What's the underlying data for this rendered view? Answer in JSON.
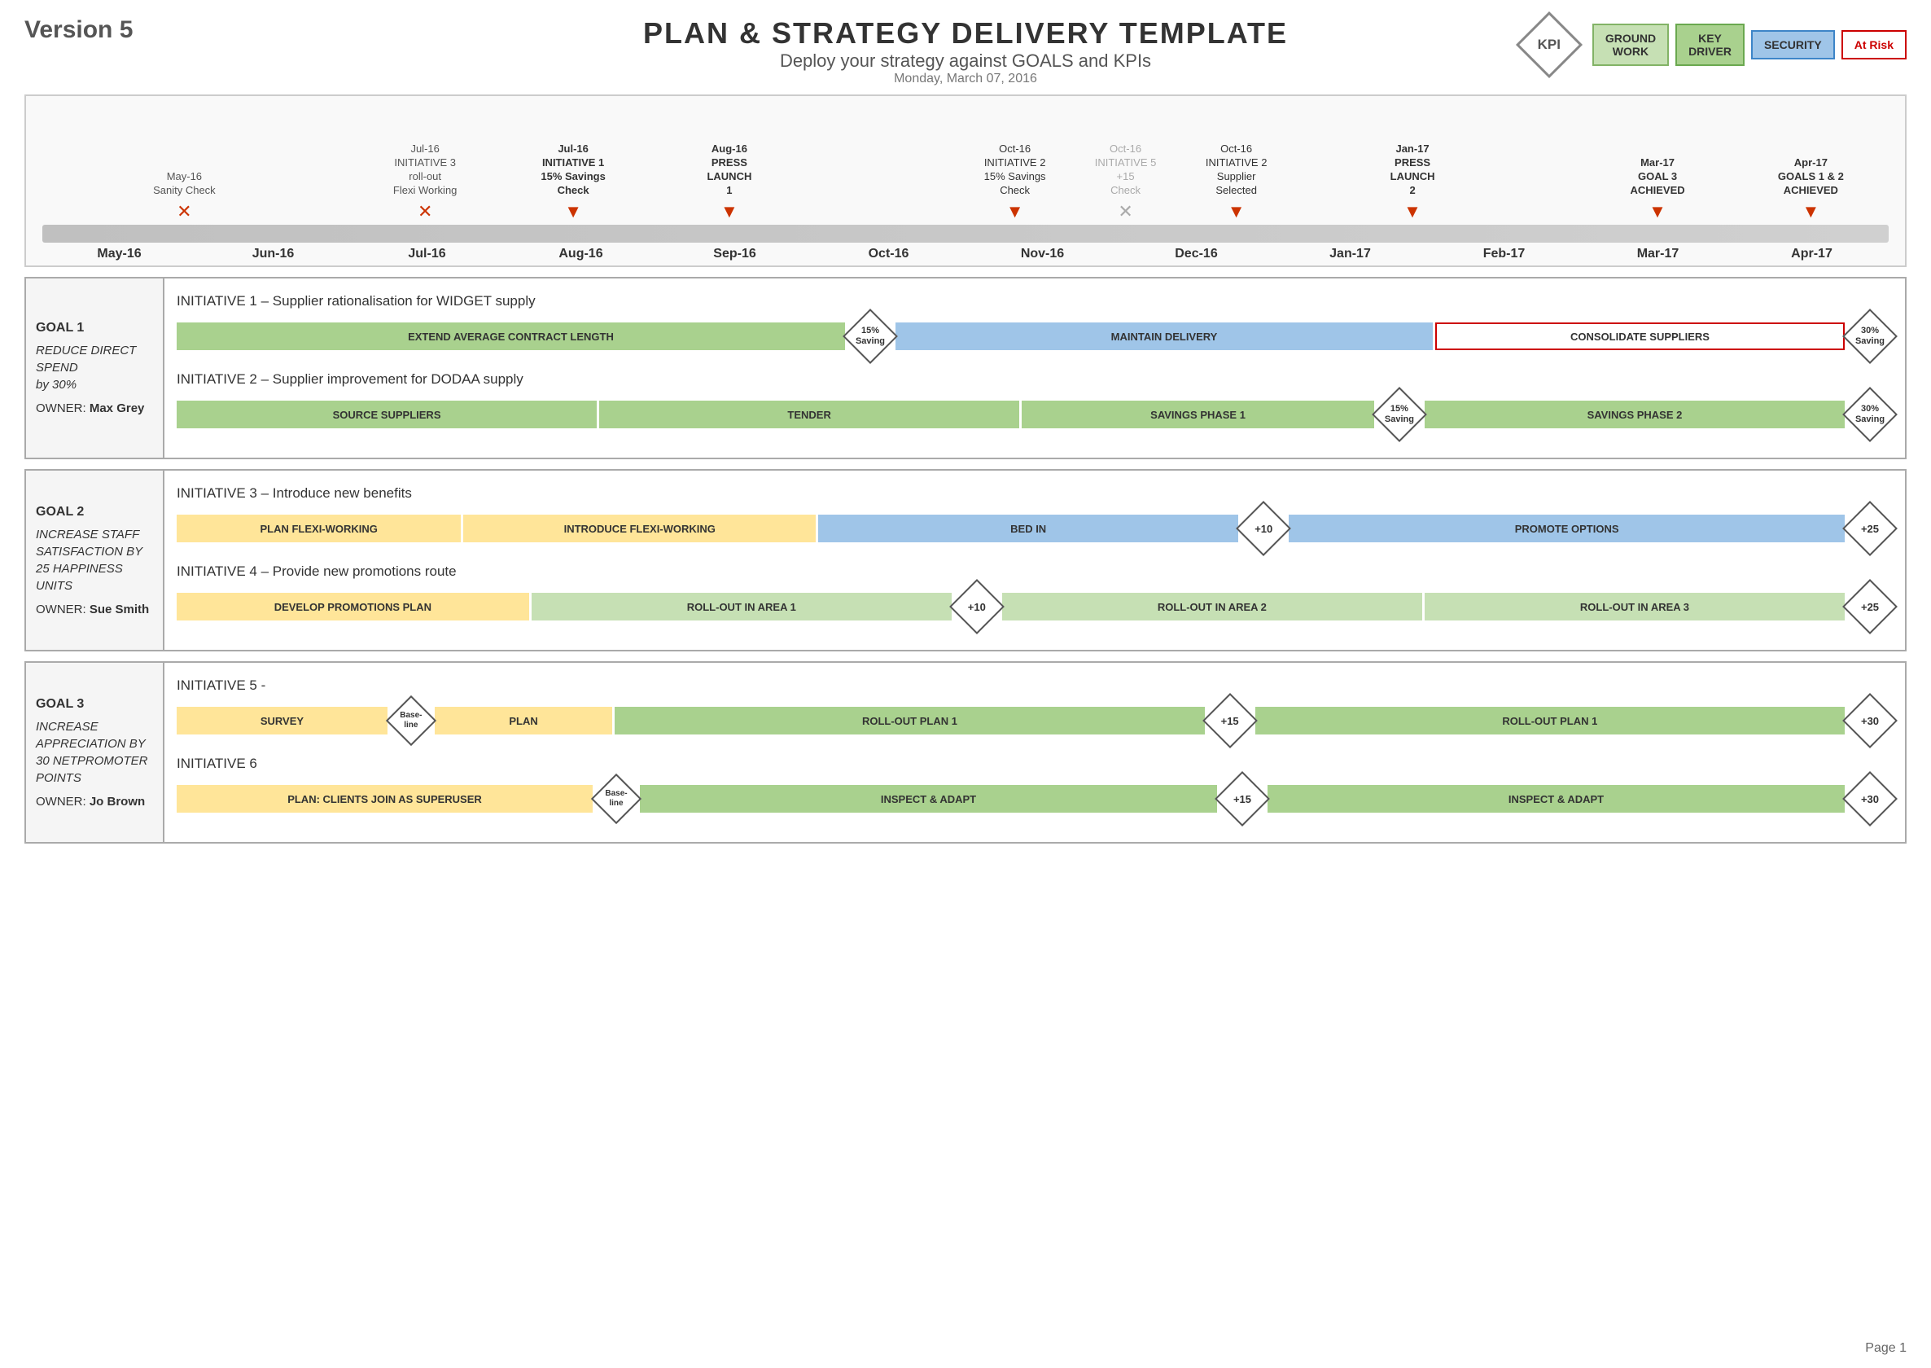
{
  "header": {
    "title": "PLAN & STRATEGY DELIVERY TEMPLATE",
    "subtitle": "Deploy your strategy against GOALS and KPIs",
    "date": "Monday, March 07, 2016",
    "version": "Version 5",
    "kpi_label": "KPI"
  },
  "legend": {
    "groundwork": "GROUND\nWORK",
    "keydriver": "KEY\nDRIVER",
    "security": "SECURITY",
    "atrisk": "At Risk"
  },
  "timeline": {
    "months": [
      "May-16",
      "Jun-16",
      "Jul-16",
      "Aug-16",
      "Sep-16",
      "Oct-16",
      "Nov-16",
      "Dec-16",
      "Jan-17",
      "Feb-17",
      "Mar-17",
      "Apr-17"
    ],
    "milestones": [
      {
        "date": "May-16",
        "label": "Sanity Check",
        "bold": false,
        "marker": "x",
        "offset": 8
      },
      {
        "date": "Jul-16",
        "label": "INITIATIVE 3\nroll-out\nFlexi Working",
        "bold": false,
        "marker": "x",
        "offset": 16
      },
      {
        "date": "Jul-16",
        "label": "Jul-16\nINITIATIVE 1\n15% Savings\nCheck",
        "bold": true,
        "marker": "arrow",
        "offset": 23
      },
      {
        "date": "Aug-16",
        "label": "Aug-16\nPRESS\nLAUNCH\n1",
        "bold": true,
        "marker": "arrow",
        "offset": 31
      },
      {
        "date": "Oct-16",
        "label": "Oct-16\nINITIATIVE 2\n15% Savings\nCheck",
        "bold": false,
        "marker": "arrow",
        "offset": 46
      },
      {
        "date": "Oct-16",
        "label": "Oct-16\nINITIATIVE 5\n+15\nCheck",
        "bold": false,
        "gray": true,
        "marker": "x",
        "offset": 52
      },
      {
        "date": "Oct-16",
        "label": "Oct-16\nINITIATIVE 2\nSupplier\nSelected",
        "bold": false,
        "marker": "arrow",
        "offset": 59
      },
      {
        "date": "Jan-17",
        "label": "Jan-17\nPRESS\nLAUNCH\n2",
        "bold": true,
        "marker": "arrow",
        "offset": 70
      },
      {
        "date": "Mar-17",
        "label": "Mar-17\nGOAL 3\nACHIEVED",
        "bold": true,
        "marker": "arrow",
        "offset": 85
      },
      {
        "date": "Apr-17",
        "label": "Apr-17\nGOALS 1 & 2\nACHIEVED",
        "bold": true,
        "marker": "arrow",
        "offset": 93
      }
    ]
  },
  "goals": [
    {
      "id": "goal1",
      "header": "GOAL 1",
      "sidebar": {
        "text": "REDUCE DIRECT SPEND\nby 30%",
        "owner_label": "OWNER:",
        "owner_name": "Max Grey"
      },
      "initiatives": [
        {
          "title": "INITIATIVE 1 – Supplier rationalisation for WIDGET supply",
          "bars": [
            {
              "label": "EXTEND AVERAGE CONTRACT LENGTH",
              "type": "green",
              "flex": 5
            },
            {
              "label": "15%\nSaving",
              "type": "diamond",
              "size": "normal"
            },
            {
              "label": "MAINTAIN DELIVERY",
              "type": "blue",
              "flex": 4
            },
            {
              "label": "CONSOLIDATE SUPPLIERS",
              "type": "red-outline",
              "flex": 3
            },
            {
              "label": "30%\nSaving",
              "type": "diamond",
              "size": "normal"
            }
          ]
        },
        {
          "title": "INITIATIVE 2 – Supplier improvement for DODAA supply",
          "bars": [
            {
              "label": "SOURCE SUPPLIERS",
              "type": "green",
              "flex": 3
            },
            {
              "label": "TENDER",
              "type": "green",
              "flex": 3
            },
            {
              "label": "SAVINGS PHASE 1",
              "type": "green",
              "flex": 2.5
            },
            {
              "label": "15%\nSaving",
              "type": "diamond",
              "size": "normal"
            },
            {
              "label": "SAVINGS PHASE 2",
              "type": "green",
              "flex": 3
            },
            {
              "label": "30%\nSaving",
              "type": "diamond",
              "size": "normal"
            }
          ]
        }
      ]
    },
    {
      "id": "goal2",
      "header": "GOAL 2",
      "sidebar": {
        "text": "INCREASE STAFF SATISFACTION BY 25 HAPPINESS UNITS",
        "owner_label": "OWNER:",
        "owner_name": "Sue Smith"
      },
      "initiatives": [
        {
          "title": "INITIATIVE 3 – Introduce new benefits",
          "bars": [
            {
              "label": "PLAN FLEXI-WORKING",
              "type": "yellow",
              "flex": 2
            },
            {
              "label": "INTRODUCE FLEXI-WORKING",
              "type": "yellow",
              "flex": 2.5
            },
            {
              "label": "BED IN",
              "type": "blue",
              "flex": 3
            },
            {
              "label": "+10",
              "type": "diamond",
              "size": "normal"
            },
            {
              "label": "PROMOTE OPTIONS",
              "type": "blue",
              "flex": 4
            },
            {
              "label": "+25",
              "type": "diamond",
              "size": "normal"
            }
          ]
        },
        {
          "title": "INITIATIVE 4 – Provide new promotions route",
          "bars": [
            {
              "label": "DEVELOP PROMOTIONS PLAN",
              "type": "yellow",
              "flex": 2.5
            },
            {
              "label": "ROLL-OUT IN AREA 1",
              "type": "light-green",
              "flex": 3
            },
            {
              "label": "+10",
              "type": "diamond",
              "size": "normal"
            },
            {
              "label": "ROLL-OUT IN AREA 2",
              "type": "light-green",
              "flex": 3
            },
            {
              "label": "ROLL-OUT IN AREA 3",
              "type": "light-green",
              "flex": 3
            },
            {
              "label": "+25",
              "type": "diamond",
              "size": "normal"
            }
          ]
        }
      ]
    },
    {
      "id": "goal3",
      "header": "GOAL 3",
      "sidebar": {
        "text": "INCREASE APPRECIATION BY 30 NETPROMOTER POINTS",
        "owner_label": "OWNER:",
        "owner_name": "Jo Brown"
      },
      "initiatives": [
        {
          "title": "INITIATIVE 5 -",
          "bars": [
            {
              "label": "SURVEY",
              "type": "yellow",
              "flex": 1.2
            },
            {
              "label": "Base-\nline",
              "type": "diamond",
              "size": "small"
            },
            {
              "label": "PLAN",
              "type": "yellow",
              "flex": 1
            },
            {
              "label": "ROLL-OUT PLAN 1",
              "type": "green",
              "flex": 3.5
            },
            {
              "label": "+15",
              "type": "diamond",
              "size": "normal"
            },
            {
              "label": "ROLL-OUT PLAN 1",
              "type": "green",
              "flex": 3.5
            },
            {
              "label": "+30",
              "type": "diamond",
              "size": "normal"
            }
          ]
        },
        {
          "title": "INITIATIVE 6",
          "bars": [
            {
              "label": "PLAN: CLIENTS JOIN AS SUPERUSER",
              "type": "yellow",
              "flex": 2.5
            },
            {
              "label": "Base-\nline",
              "type": "diamond",
              "size": "small"
            },
            {
              "label": "INSPECT & ADAPT",
              "type": "green",
              "flex": 3.5
            },
            {
              "label": "+15",
              "type": "diamond",
              "size": "normal"
            },
            {
              "label": "INSPECT & ADAPT",
              "type": "green",
              "flex": 3.5
            },
            {
              "label": "+30",
              "type": "diamond",
              "size": "normal"
            }
          ]
        }
      ]
    }
  ],
  "page_number": "Page 1"
}
